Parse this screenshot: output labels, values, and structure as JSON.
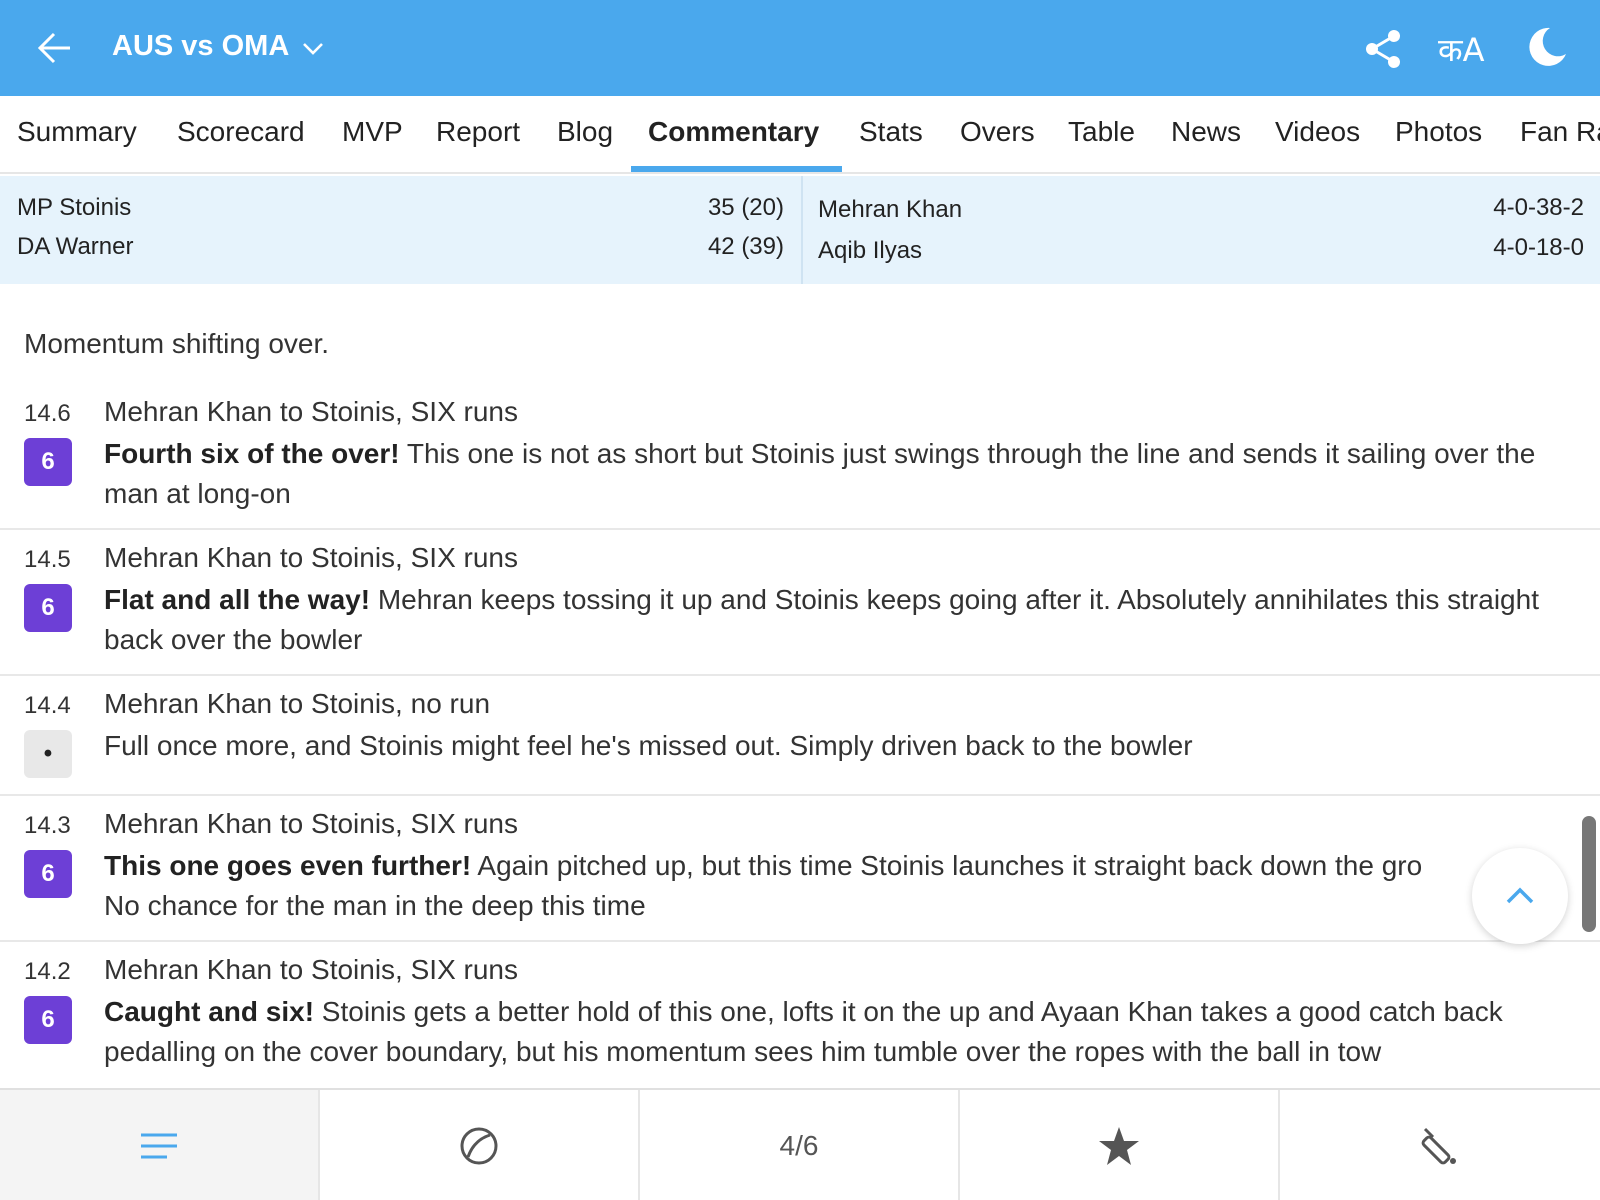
{
  "header": {
    "title": "AUS vs OMA",
    "lang_label": "कA",
    "colors": {
      "bar": "#4aa8ed",
      "active_tab": "#4aa8ed",
      "six_badge": "#6d3fd6"
    }
  },
  "tabs": [
    {
      "label": "Summary"
    },
    {
      "label": "Scorecard"
    },
    {
      "label": "MVP"
    },
    {
      "label": "Report"
    },
    {
      "label": "Blog"
    },
    {
      "label": "Commentary",
      "active": true
    },
    {
      "label": "Stats"
    },
    {
      "label": "Overs"
    },
    {
      "label": "Table"
    },
    {
      "label": "News"
    },
    {
      "label": "Videos"
    },
    {
      "label": "Photos"
    },
    {
      "label": "Fan Ra"
    }
  ],
  "batters": [
    {
      "name": "MP Stoinis",
      "score": "35 (20)"
    },
    {
      "name": "DA Warner",
      "score": "42 (39)"
    }
  ],
  "bowlers": [
    {
      "name": "Mehran Khan",
      "figures": "4-0-38-2"
    },
    {
      "name": "Aqib Ilyas",
      "figures": "4-0-18-0"
    }
  ],
  "intro": "Momentum shifting over.",
  "balls": [
    {
      "over": "14.6",
      "badge": "6",
      "headline": "Mehran Khan to Stoinis, SIX runs",
      "bold": "Fourth six of the over!",
      "text": " This one is not as short but Stoinis just swings through the line and sends it sailing over the man at long-on"
    },
    {
      "over": "14.5",
      "badge": "6",
      "headline": "Mehran Khan to Stoinis, SIX runs",
      "bold": "Flat and all the way!",
      "text": " Mehran keeps tossing it up and Stoinis keeps going after it. Absolutely annihilates this straight back over the bowler"
    },
    {
      "over": "14.4",
      "badge": "•",
      "headline": "Mehran Khan to Stoinis, no run",
      "bold": "",
      "text": "Full once more, and Stoinis might feel he's missed out. Simply driven back to the bowler"
    },
    {
      "over": "14.3",
      "badge": "6",
      "headline": "Mehran Khan to Stoinis, SIX runs",
      "bold": "This one goes even further!",
      "text": " Again pitched up, but this time Stoinis launches it straight back down the gro",
      "text2": "No chance for the man in the deep this time"
    },
    {
      "over": "14.2",
      "badge": "6",
      "headline": "Mehran Khan to Stoinis, SIX runs",
      "bold": "Caught and six!",
      "text": " Stoinis gets a better hold of this one, lofts it on the up and Ayaan Khan takes a good catch back pedalling on the cover boundary, but his momentum sees him tumble over the ropes with the ball in tow"
    }
  ],
  "bottom_nav": {
    "page_indicator": "4/6",
    "icons": [
      "menu-icon",
      "ball-icon",
      "page-indicator",
      "star-icon",
      "bat-icon"
    ]
  }
}
